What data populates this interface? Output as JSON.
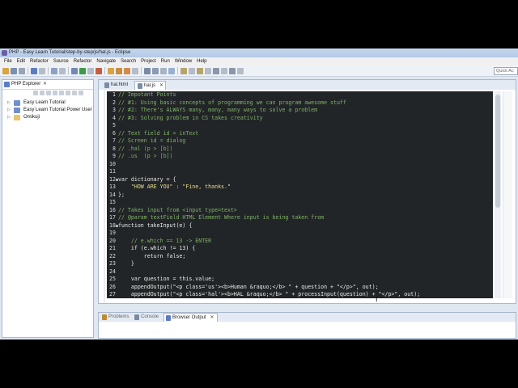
{
  "window": {
    "title": "PHP - Easy Learn Tutorial/step-by-step/js/hal.js - Eclipse"
  },
  "menu": [
    "File",
    "Edit",
    "Refactor",
    "Source",
    "Refactor",
    "Navigate",
    "Search",
    "Project",
    "Run",
    "Window",
    "Help"
  ],
  "toolbar": {
    "quick_access_placeholder": "Quick Ac"
  },
  "explorer": {
    "tab_label": "PHP Explorer",
    "items": [
      {
        "label": "Easy Learn Tutorial",
        "icon": "project-icon"
      },
      {
        "label": "Easy Learn Tutorial Power User",
        "icon": "project-icon"
      },
      {
        "label": "Omikuji",
        "icon": "project-icon"
      }
    ]
  },
  "editor": {
    "tabs": [
      {
        "label": "hal.html",
        "active": false
      },
      {
        "label": "hal.js",
        "active": true
      }
    ],
    "lines": [
      {
        "n": "1",
        "text": "// Impotant Points",
        "cls": "cm"
      },
      {
        "n": "2",
        "text": "// #1: Using basic concepts of programming we can program awesome stuff",
        "cls": "cm"
      },
      {
        "n": "3",
        "text": "// #2: There's ALWAYS many, many, many ways to solve a problem",
        "cls": "cm"
      },
      {
        "n": "4",
        "text": "// #3: Solving problem in CS takes creativity",
        "cls": "cm"
      },
      {
        "n": "5",
        "text": "",
        "cls": ""
      },
      {
        "n": "6",
        "text": "// Text field id = inText",
        "cls": "cm"
      },
      {
        "n": "7",
        "text": "// Screen id = dialog",
        "cls": "cm"
      },
      {
        "n": "8",
        "text": "// .hal (p > [b])",
        "cls": "cm"
      },
      {
        "n": "9",
        "text": "// .us  (p > [b])",
        "cls": "cm"
      },
      {
        "n": "10",
        "text": "",
        "cls": ""
      },
      {
        "n": "11",
        "text": "",
        "cls": ""
      },
      {
        "n": "12",
        "text": "var dictionary = {",
        "cls": ""
      },
      {
        "n": "13",
        "text": "    \"HOW ARE YOU\" : \"Fine, thanks.\"",
        "cls": "str"
      },
      {
        "n": "14",
        "text": "};",
        "cls": ""
      },
      {
        "n": "15",
        "text": "",
        "cls": ""
      },
      {
        "n": "16",
        "text": "// Takes input from <input type=text>",
        "cls": "cm"
      },
      {
        "n": "17",
        "text": "// @param textField HTML Element Where input is being taken from",
        "cls": "cm"
      },
      {
        "n": "18",
        "text": "function takeInput(e) {",
        "cls": ""
      },
      {
        "n": "19",
        "text": "",
        "cls": ""
      },
      {
        "n": "20",
        "text": "    // e.which == 13 -> ENTER",
        "cls": "cm"
      },
      {
        "n": "21",
        "text": "    if (e.which != 13) {",
        "cls": ""
      },
      {
        "n": "22",
        "text": "        return false;",
        "cls": ""
      },
      {
        "n": "23",
        "text": "    }",
        "cls": ""
      },
      {
        "n": "24",
        "text": "",
        "cls": ""
      },
      {
        "n": "25",
        "text": "    var question = this.value;",
        "cls": ""
      },
      {
        "n": "26",
        "text": "    appendOutput(\"<p class='us'><b>Human &raquo;</b> \" + question + \"</p>\", out);",
        "cls": ""
      },
      {
        "n": "27",
        "text": "    appendOutput(\"<p class='hal'><b>HAL &raquo;</b> \" + processInput(question) + \"</p>\", out);",
        "cls": ""
      }
    ]
  },
  "bottom_panel": {
    "tabs": [
      {
        "label": "Problems",
        "active": false
      },
      {
        "label": "Console",
        "active": false
      },
      {
        "label": "Browser Output",
        "active": true
      }
    ]
  }
}
